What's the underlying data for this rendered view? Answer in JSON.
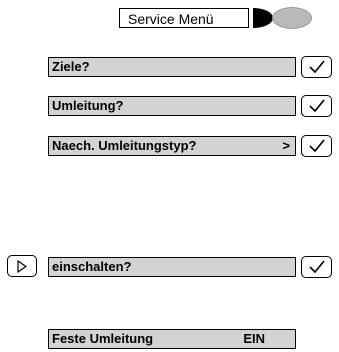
{
  "header": {
    "service_menu_label": "Service Menü"
  },
  "menu": {
    "items": [
      {
        "label": "Ziele?",
        "arrow": ""
      },
      {
        "label": "Umleitung?",
        "arrow": ""
      },
      {
        "label": "Naech. Umleitungstyp?",
        "arrow": ">"
      },
      {
        "label": "einschalten?",
        "arrow": ""
      }
    ]
  },
  "status": {
    "label": "Feste Umleitung",
    "value": "EIN"
  },
  "icons": {
    "confirm": "checkmark-icon",
    "select": "play-triangle-icon",
    "display_half": "half-circle-icon",
    "display_oval": "oval-icon"
  }
}
